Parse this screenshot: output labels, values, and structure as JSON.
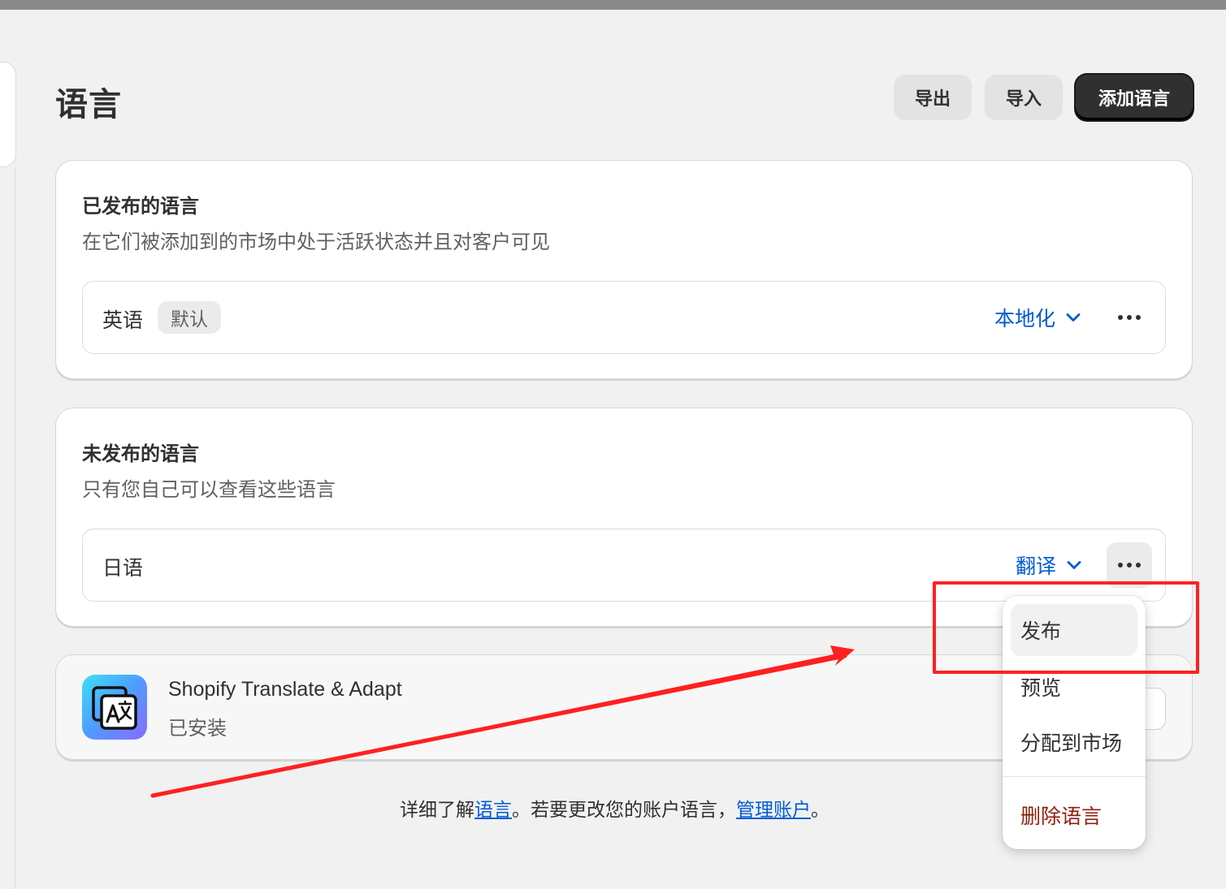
{
  "header": {
    "title": "语言",
    "export_label": "导出",
    "import_label": "导入",
    "add_language_label": "添加语言"
  },
  "published": {
    "title": "已发布的语言",
    "subtitle": "在它们被添加到的市场中处于活跃状态并且对客户可见",
    "language": {
      "name": "英语",
      "badge": "默认",
      "action": "本地化"
    }
  },
  "unpublished": {
    "title": "未发布的语言",
    "subtitle": "只有您自己可以查看这些语言",
    "language": {
      "name": "日语",
      "action": "翻译"
    }
  },
  "app": {
    "name": "Shopify Translate & Adapt",
    "status": "已安装",
    "icon": "translate-icon"
  },
  "footer": {
    "prefix": "详细了解",
    "link1": "语言",
    "middle": "。若要更改您的账户语言，",
    "link2": "管理账户",
    "suffix": "。"
  },
  "dropdown_menu": {
    "items": [
      "发布",
      "预览",
      "分配到市场"
    ],
    "danger_item": "删除语言"
  },
  "colors": {
    "accent_link": "#005bd3",
    "primary_button": "#303030",
    "danger": "#8e1f0b",
    "annotation": "#ff2020"
  }
}
